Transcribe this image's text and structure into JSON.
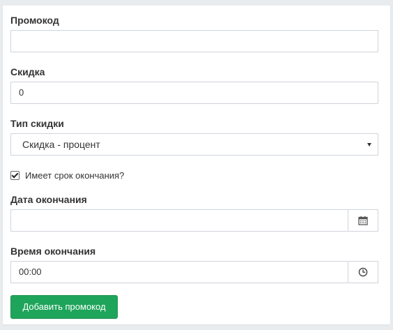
{
  "form": {
    "promo_label": "Промокод",
    "promo_value": "",
    "discount_label": "Скидка",
    "discount_value": "0",
    "discount_type_label": "Тип скидки",
    "discount_type_selected": "Скидка - процент",
    "has_expiry_label": "Имеет срок окончания?",
    "has_expiry_checked": true,
    "end_date_label": "Дата окончания",
    "end_date_value": "",
    "end_time_label": "Время окончания",
    "end_time_value": "00:00",
    "submit_label": "Добавить промокод"
  },
  "icons": {
    "calendar": "calendar-icon",
    "clock": "clock-icon",
    "caret": "chevron-down-icon"
  },
  "colors": {
    "primary_button": "#1fa55b",
    "border": "#cfd4da",
    "background": "#e9ecef"
  }
}
